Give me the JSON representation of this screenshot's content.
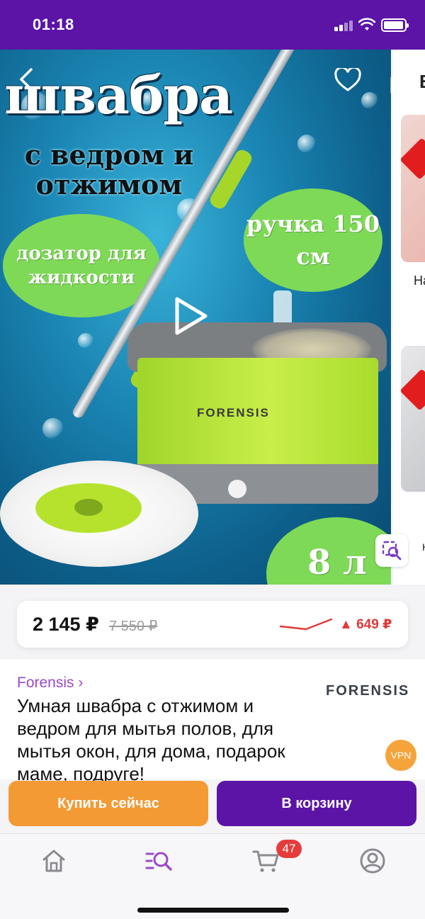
{
  "status_bar": {
    "time": "01:18"
  },
  "gallery": {
    "headline": "швабра",
    "subheadline": "с ведром и отжимом",
    "badge_dispenser": "дозатор для жидкости",
    "badge_handle": "ручка 150 см",
    "badge_volume": "8 л",
    "bucket_brand": "FORENSIS",
    "side_header": "В",
    "side_item_1": "На",
    "side_item_2": "Н"
  },
  "price": {
    "current": "2 145 ₽",
    "old": "7 550 ₽",
    "change": "▲ 649 ₽",
    "change_color": "#e03a3a"
  },
  "product": {
    "brand": "Forensis ›",
    "brand_logo": "FORENSIS",
    "title": "Умная швабра с отжимом и ведром для мытья полов, для мытья окон, для дома, подарок маме, подруге!",
    "vpn_badge": "VPN"
  },
  "actions": {
    "buy_now": "Купить сейчас",
    "add_to_cart": "В корзину"
  },
  "tab_bar": {
    "items": [
      {
        "icon": "home-icon"
      },
      {
        "icon": "catalog-search-icon",
        "active": true
      },
      {
        "icon": "cart-icon"
      },
      {
        "icon": "profile-icon"
      }
    ],
    "cart_count": "47"
  },
  "colors": {
    "brand_purple": "#5b14a6",
    "accent_orange": "#f39a34",
    "link_purple": "#9b4ac9"
  }
}
